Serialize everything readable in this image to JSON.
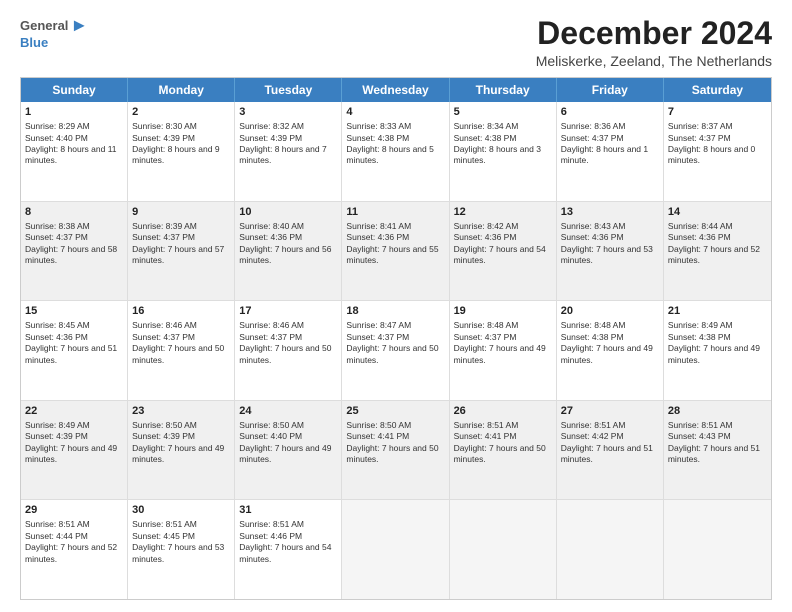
{
  "header": {
    "logo_general": "General",
    "logo_blue": "Blue",
    "month_title": "December 2024",
    "subtitle": "Meliskerke, Zeeland, The Netherlands"
  },
  "days": [
    "Sunday",
    "Monday",
    "Tuesday",
    "Wednesday",
    "Thursday",
    "Friday",
    "Saturday"
  ],
  "rows": [
    [
      {
        "day": "1",
        "sunrise": "Sunrise: 8:29 AM",
        "sunset": "Sunset: 4:40 PM",
        "daylight": "Daylight: 8 hours and 11 minutes."
      },
      {
        "day": "2",
        "sunrise": "Sunrise: 8:30 AM",
        "sunset": "Sunset: 4:39 PM",
        "daylight": "Daylight: 8 hours and 9 minutes."
      },
      {
        "day": "3",
        "sunrise": "Sunrise: 8:32 AM",
        "sunset": "Sunset: 4:39 PM",
        "daylight": "Daylight: 8 hours and 7 minutes."
      },
      {
        "day": "4",
        "sunrise": "Sunrise: 8:33 AM",
        "sunset": "Sunset: 4:38 PM",
        "daylight": "Daylight: 8 hours and 5 minutes."
      },
      {
        "day": "5",
        "sunrise": "Sunrise: 8:34 AM",
        "sunset": "Sunset: 4:38 PM",
        "daylight": "Daylight: 8 hours and 3 minutes."
      },
      {
        "day": "6",
        "sunrise": "Sunrise: 8:36 AM",
        "sunset": "Sunset: 4:37 PM",
        "daylight": "Daylight: 8 hours and 1 minute."
      },
      {
        "day": "7",
        "sunrise": "Sunrise: 8:37 AM",
        "sunset": "Sunset: 4:37 PM",
        "daylight": "Daylight: 8 hours and 0 minutes."
      }
    ],
    [
      {
        "day": "8",
        "sunrise": "Sunrise: 8:38 AM",
        "sunset": "Sunset: 4:37 PM",
        "daylight": "Daylight: 7 hours and 58 minutes."
      },
      {
        "day": "9",
        "sunrise": "Sunrise: 8:39 AM",
        "sunset": "Sunset: 4:37 PM",
        "daylight": "Daylight: 7 hours and 57 minutes."
      },
      {
        "day": "10",
        "sunrise": "Sunrise: 8:40 AM",
        "sunset": "Sunset: 4:36 PM",
        "daylight": "Daylight: 7 hours and 56 minutes."
      },
      {
        "day": "11",
        "sunrise": "Sunrise: 8:41 AM",
        "sunset": "Sunset: 4:36 PM",
        "daylight": "Daylight: 7 hours and 55 minutes."
      },
      {
        "day": "12",
        "sunrise": "Sunrise: 8:42 AM",
        "sunset": "Sunset: 4:36 PM",
        "daylight": "Daylight: 7 hours and 54 minutes."
      },
      {
        "day": "13",
        "sunrise": "Sunrise: 8:43 AM",
        "sunset": "Sunset: 4:36 PM",
        "daylight": "Daylight: 7 hours and 53 minutes."
      },
      {
        "day": "14",
        "sunrise": "Sunrise: 8:44 AM",
        "sunset": "Sunset: 4:36 PM",
        "daylight": "Daylight: 7 hours and 52 minutes."
      }
    ],
    [
      {
        "day": "15",
        "sunrise": "Sunrise: 8:45 AM",
        "sunset": "Sunset: 4:36 PM",
        "daylight": "Daylight: 7 hours and 51 minutes."
      },
      {
        "day": "16",
        "sunrise": "Sunrise: 8:46 AM",
        "sunset": "Sunset: 4:37 PM",
        "daylight": "Daylight: 7 hours and 50 minutes."
      },
      {
        "day": "17",
        "sunrise": "Sunrise: 8:46 AM",
        "sunset": "Sunset: 4:37 PM",
        "daylight": "Daylight: 7 hours and 50 minutes."
      },
      {
        "day": "18",
        "sunrise": "Sunrise: 8:47 AM",
        "sunset": "Sunset: 4:37 PM",
        "daylight": "Daylight: 7 hours and 50 minutes."
      },
      {
        "day": "19",
        "sunrise": "Sunrise: 8:48 AM",
        "sunset": "Sunset: 4:37 PM",
        "daylight": "Daylight: 7 hours and 49 minutes."
      },
      {
        "day": "20",
        "sunrise": "Sunrise: 8:48 AM",
        "sunset": "Sunset: 4:38 PM",
        "daylight": "Daylight: 7 hours and 49 minutes."
      },
      {
        "day": "21",
        "sunrise": "Sunrise: 8:49 AM",
        "sunset": "Sunset: 4:38 PM",
        "daylight": "Daylight: 7 hours and 49 minutes."
      }
    ],
    [
      {
        "day": "22",
        "sunrise": "Sunrise: 8:49 AM",
        "sunset": "Sunset: 4:39 PM",
        "daylight": "Daylight: 7 hours and 49 minutes."
      },
      {
        "day": "23",
        "sunrise": "Sunrise: 8:50 AM",
        "sunset": "Sunset: 4:39 PM",
        "daylight": "Daylight: 7 hours and 49 minutes."
      },
      {
        "day": "24",
        "sunrise": "Sunrise: 8:50 AM",
        "sunset": "Sunset: 4:40 PM",
        "daylight": "Daylight: 7 hours and 49 minutes."
      },
      {
        "day": "25",
        "sunrise": "Sunrise: 8:50 AM",
        "sunset": "Sunset: 4:41 PM",
        "daylight": "Daylight: 7 hours and 50 minutes."
      },
      {
        "day": "26",
        "sunrise": "Sunrise: 8:51 AM",
        "sunset": "Sunset: 4:41 PM",
        "daylight": "Daylight: 7 hours and 50 minutes."
      },
      {
        "day": "27",
        "sunrise": "Sunrise: 8:51 AM",
        "sunset": "Sunset: 4:42 PM",
        "daylight": "Daylight: 7 hours and 51 minutes."
      },
      {
        "day": "28",
        "sunrise": "Sunrise: 8:51 AM",
        "sunset": "Sunset: 4:43 PM",
        "daylight": "Daylight: 7 hours and 51 minutes."
      }
    ],
    [
      {
        "day": "29",
        "sunrise": "Sunrise: 8:51 AM",
        "sunset": "Sunset: 4:44 PM",
        "daylight": "Daylight: 7 hours and 52 minutes."
      },
      {
        "day": "30",
        "sunrise": "Sunrise: 8:51 AM",
        "sunset": "Sunset: 4:45 PM",
        "daylight": "Daylight: 7 hours and 53 minutes."
      },
      {
        "day": "31",
        "sunrise": "Sunrise: 8:51 AM",
        "sunset": "Sunset: 4:46 PM",
        "daylight": "Daylight: 7 hours and 54 minutes."
      },
      null,
      null,
      null,
      null
    ]
  ]
}
